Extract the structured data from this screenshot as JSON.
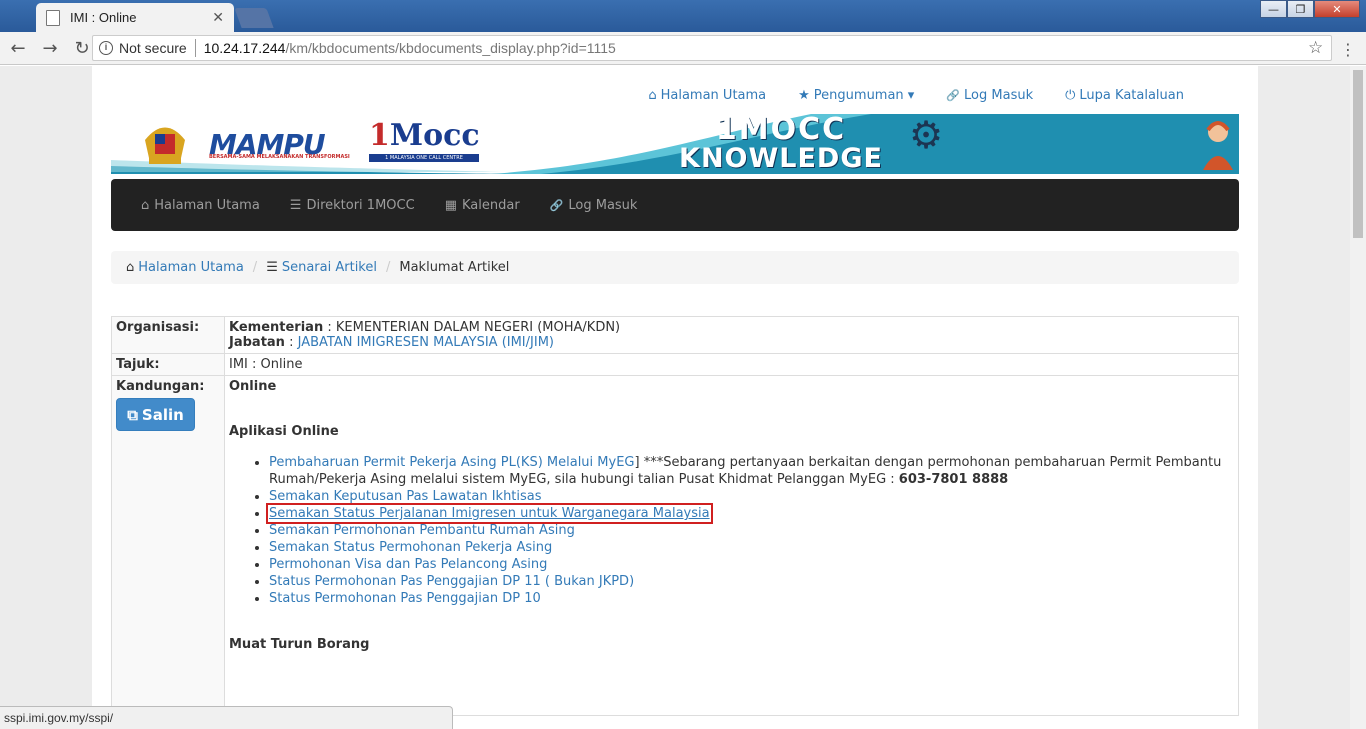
{
  "browser": {
    "tab_title": "IMI : Online",
    "tab_close": "✕",
    "security_label": "Not secure",
    "url_host": "10.24.17.244",
    "url_path": "/km/kbdocuments/kbdocuments_display.php?id=1115",
    "window_buttons": {
      "minimize": "—",
      "maximize": "❐",
      "close": "✕"
    },
    "status_url": "sspi.imi.gov.my/sspi/"
  },
  "top_nav": [
    {
      "icon": "home-icon",
      "glyph": "⌂",
      "label": "Halaman Utama"
    },
    {
      "icon": "star-icon",
      "glyph": "★",
      "label": "Pengumuman ▾"
    },
    {
      "icon": "link-icon",
      "glyph": "🔗",
      "label": "Log Masuk"
    },
    {
      "icon": "power-icon",
      "glyph": "⏻",
      "label": "Lupa Katalaluan"
    }
  ],
  "banner": {
    "logo_mampu": "MAMPU",
    "logo_mampu_tagline": "BERSAMA-SAMA MELAKSANAKAN TRANSFORMASI",
    "logo_mocc_1": "1",
    "logo_mocc_rest": "Mocc",
    "logo_mocc_tagline": "1 MALAYSIA ONE CALL CENTRE",
    "title_line1": "1MOCC",
    "title_line2": "KNOWLEDGE MANAGEMENT",
    "colors": {
      "banner_teal": "#1f8fb0",
      "banner_light": "#5cc4d8"
    }
  },
  "main_nav": [
    {
      "icon": "home-icon",
      "glyph": "⌂",
      "label": "Halaman Utama"
    },
    {
      "icon": "list-icon",
      "glyph": "☰",
      "label": "Direktori 1MOCC"
    },
    {
      "icon": "calendar-icon",
      "glyph": "▦",
      "label": "Kalendar"
    },
    {
      "icon": "link-icon",
      "glyph": "🔗",
      "label": "Log Masuk"
    }
  ],
  "breadcrumb": {
    "home": "Halaman Utama",
    "list": "Senarai Artikel",
    "current": "Maklumat Artikel",
    "divider": "/"
  },
  "article": {
    "organisasi_label": "Organisasi:",
    "kementerian_label": "Kementerian",
    "kementerian_value": ": KEMENTERIAN DALAM NEGERI (MOHA/KDN)",
    "jabatan_label": "Jabatan",
    "jabatan_colon": ": ",
    "jabatan_value": "JABATAN IMIGRESEN MALAYSIA (IMI/JIM)",
    "tajuk_label": "Tajuk:",
    "tajuk_value": "IMI : Online",
    "kandungan_label": "Kandungan:",
    "salin_button": "Salin",
    "heading_online": "Online",
    "heading_aplikasi": "Aplikasi Online",
    "first_link": "Pembaharuan Permit Pekerja Asing PL(KS) Melalui MyEG",
    "first_note": "] ***Sebarang pertanyaan berkaitan dengan permohonan pembaharuan Permit Pembantu Rumah/Pekerja Asing melalui sistem MyEG, sila hubungi talian Pusat Khidmat Pelanggan MyEG : ",
    "first_phone": "603-7801 8888",
    "links": [
      "Semakan Keputusan Pas Lawatan Ikhtisas",
      "Semakan Status Perjalanan Imigresen untuk Warganegara Malaysia",
      "Semakan Permohonan Pembantu Rumah Asing",
      "Semakan Status Permohonan Pekerja Asing",
      "Permohonan Visa dan Pas Pelancong Asing",
      "Status Permohonan Pas Penggajian DP 11 ( Bukan JKPD)",
      "Status Permohonan Pas Penggajian DP 10"
    ],
    "heading_muat": "Muat Turun Borang"
  }
}
